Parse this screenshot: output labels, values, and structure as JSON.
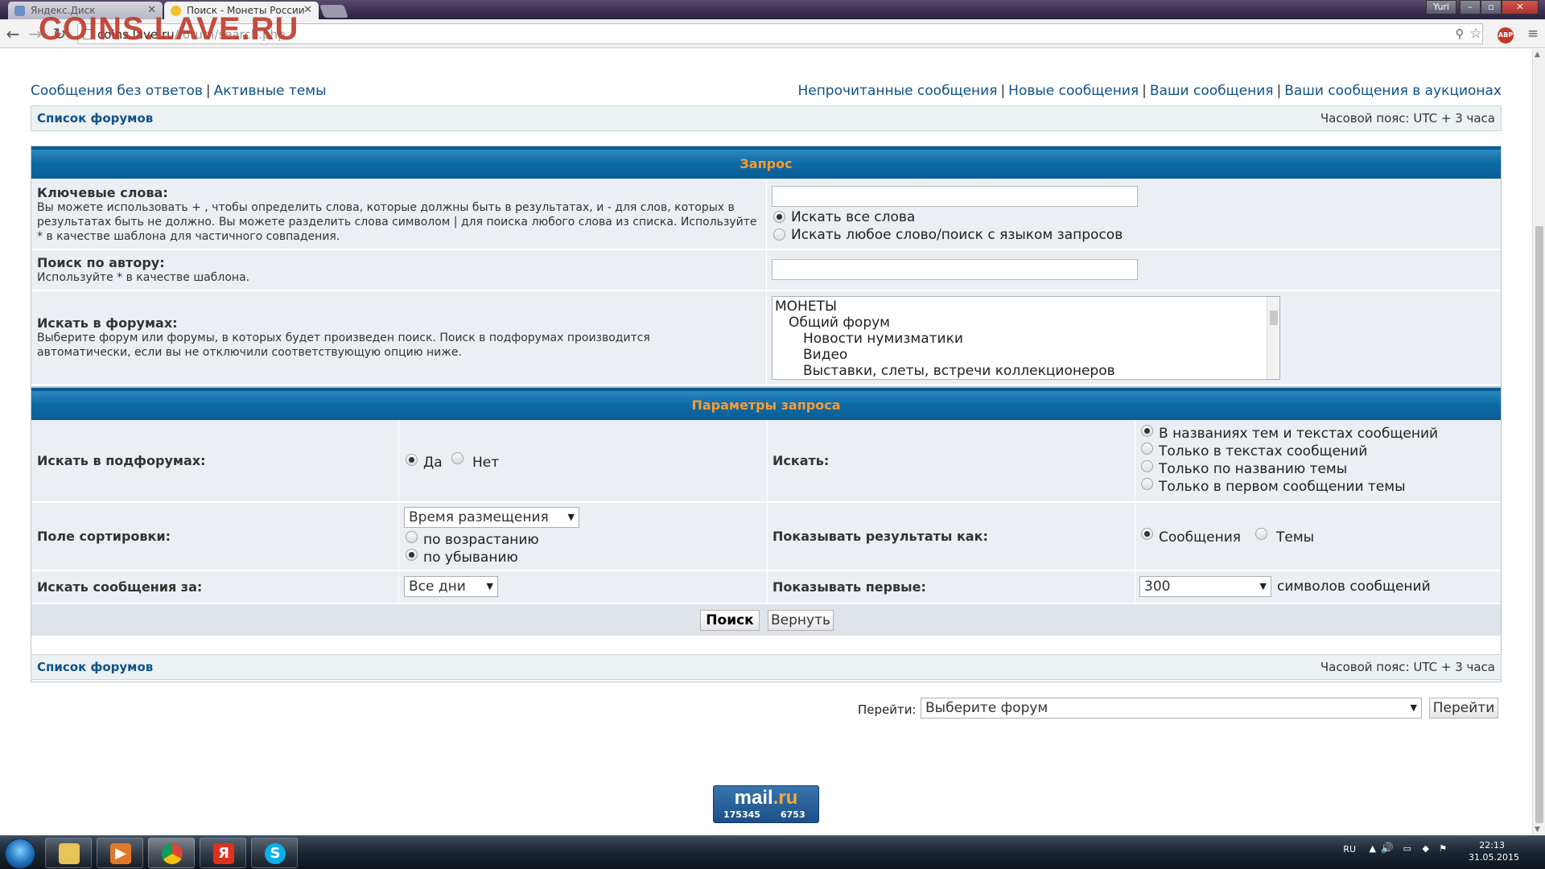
{
  "browser": {
    "tabs": [
      {
        "label": "Яндекс.Диск"
      },
      {
        "label": "Поиск - Монеты России"
      }
    ],
    "url_host": "coins.lave.ru",
    "url_path": "/forum/search.php",
    "watermark": "COINS.LAVE.RU",
    "window_user": "Yuri",
    "abp_label": "ABP"
  },
  "header": {
    "left_links": [
      "Сообщения без ответов",
      "Активные темы"
    ],
    "right_links": [
      "Непрочитанные сообщения",
      "Новые сообщения",
      "Ваши сообщения",
      "Ваши сообщения в аукционах"
    ],
    "separator": "|"
  },
  "navbar": {
    "forum_list": "Список форумов",
    "timezone": "Часовой пояс: UTC + 3 часа"
  },
  "query": {
    "title": "Запрос",
    "keywords_label": "Ключевые слова:",
    "keywords_desc": "Вы можете использовать + , чтобы определить слова, которые должны быть в результатах, и - для слов, которых в результатах быть не должно. Вы можете разделить слова символом | для поиска любого слова из списка. Используйте * в качестве шаблона для частичного совпадения.",
    "terms_all": "Искать все слова",
    "terms_any": "Искать любое слово/поиск с языком запросов",
    "author_label": "Поиск по автору:",
    "author_desc": "Используйте * в качестве шаблона.",
    "forums_label": "Искать в форумах:",
    "forums_desc": "Выберите форум или форумы, в которых будет произведен поиск. Поиск в подфорумах производится автоматически, если вы не отключили соответствующую опцию ниже.",
    "forum_options": [
      "МОНЕТЫ",
      "Общий форум",
      "Новости нумизматики",
      "Видео",
      "Выставки, слеты, встречи коллекционеров"
    ]
  },
  "params": {
    "title": "Параметры запроса",
    "subforums_label": "Искать в подфорумах:",
    "yes": "Да",
    "no": "Нет",
    "search_in_label": "Искать:",
    "search_in_options": [
      "В названиях тем и текстах сообщений",
      "Только в текстах сообщений",
      "Только по названию темы",
      "Только в первом сообщении темы"
    ],
    "sort_label": "Поле сортировки:",
    "sort_value": "Время размещения",
    "sort_asc": "по возрастанию",
    "sort_desc": "по убыванию",
    "show_as_label": "Показывать результаты как:",
    "show_posts": "Сообщения",
    "show_topics": "Темы",
    "period_label": "Искать сообщения за:",
    "period_value": "Все дни",
    "first_label": "Показывать первые:",
    "first_value": "300",
    "first_suffix": "символов сообщений",
    "search_btn": "Поиск",
    "reset_btn": "Вернуть"
  },
  "jump": {
    "label": "Перейти:",
    "select_value": "Выберите форум",
    "button": "Перейти"
  },
  "counter": {
    "logo_a": "mail",
    "logo_b": ".ru",
    "left": "175345",
    "right": "6753"
  },
  "taskbar": {
    "lang": "RU",
    "time": "22:13",
    "date": "31.05.2015"
  }
}
